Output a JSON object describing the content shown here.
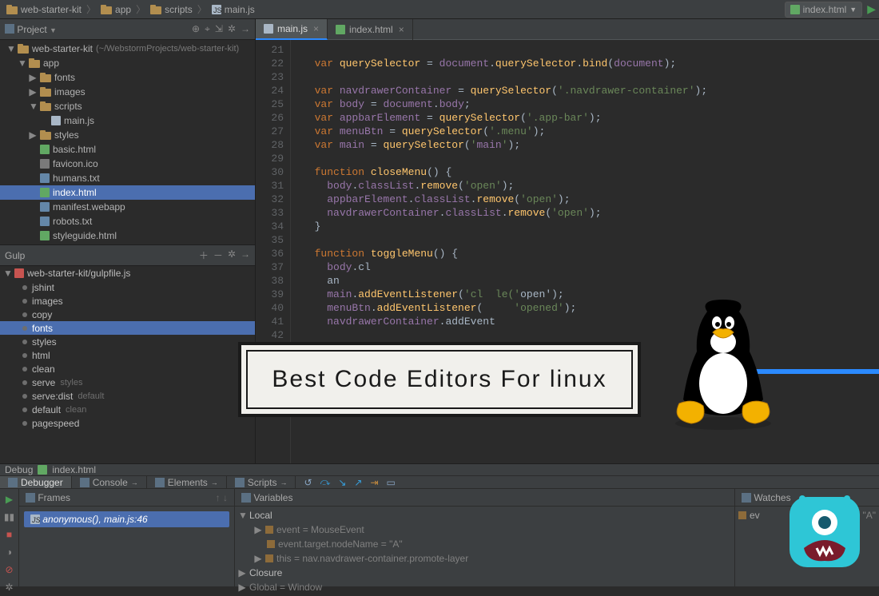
{
  "breadcrumbs": [
    "web-starter-kit",
    "app",
    "scripts",
    "main.js"
  ],
  "nav": {
    "selected_file": "index.html"
  },
  "project": {
    "title": "Project",
    "root": "web-starter-kit",
    "root_path": "(~/WebstormProjects/web-starter-kit)",
    "app_folder": "app",
    "folders": [
      "fonts",
      "images",
      "scripts",
      "styles"
    ],
    "scripts_files": [
      "main.js"
    ],
    "files": [
      "basic.html",
      "favicon.ico",
      "humans.txt",
      "index.html",
      "manifest.webapp",
      "robots.txt",
      "styleguide.html"
    ],
    "selected": "index.html"
  },
  "gulp": {
    "title": "Gulp",
    "root": "web-starter-kit/gulpfile.js",
    "tasks": [
      {
        "name": "jshint",
        "tag": ""
      },
      {
        "name": "images",
        "tag": ""
      },
      {
        "name": "copy",
        "tag": ""
      },
      {
        "name": "fonts",
        "tag": ""
      },
      {
        "name": "styles",
        "tag": ""
      },
      {
        "name": "html",
        "tag": ""
      },
      {
        "name": "clean",
        "tag": ""
      },
      {
        "name": "serve",
        "tag": "styles"
      },
      {
        "name": "serve:dist",
        "tag": "default"
      },
      {
        "name": "default",
        "tag": "clean"
      },
      {
        "name": "pagespeed",
        "tag": ""
      }
    ],
    "selected": "fonts"
  },
  "tabs": [
    {
      "name": "main.js",
      "type": "js",
      "active": true
    },
    {
      "name": "index.html",
      "type": "html",
      "active": false
    }
  ],
  "editor": {
    "first_line": 21,
    "lines": [
      "",
      "  var querySelector = document.querySelector.bind(document);",
      "",
      "  var navdrawerContainer = querySelector('.navdrawer-container');",
      "  var body = document.body;",
      "  var appbarElement = querySelector('.app-bar');",
      "  var menuBtn = querySelector('.menu');",
      "  var main = querySelector('main');",
      "",
      "  function closeMenu() {",
      "    body.classList.remove('open');",
      "    appbarElement.classList.remove('open');",
      "    navdrawerContainer.classList.remove('open');",
      "  }",
      "",
      "  function toggleMenu() {",
      "    body.cl",
      "    an",
      "    main.addEventListener('cl  le('open');",
      "    menuBtn.addEventListener(     'opened');",
      "    navdrawerContainer.addEvent",
      ""
    ]
  },
  "overlay": {
    "text": "Best Code Editors For linux"
  },
  "debug": {
    "title": "Debug",
    "target": "index.html",
    "tabs": [
      "Debugger",
      "Console",
      "Elements",
      "Scripts"
    ],
    "active_tab": "Debugger",
    "frames_title": "Frames",
    "frame": "anonymous(), main.js:46",
    "vars_title": "Variables",
    "vars": {
      "group0": "Local",
      "event": "event = MouseEvent",
      "event_target": "event.target.nodeName = \"A\"",
      "this": "this = nav.navdrawer-container.promote-layer",
      "closure": "Closure",
      "global": "Global = Window"
    },
    "watches_title": "Watches",
    "watch": "ame = \"A\""
  }
}
